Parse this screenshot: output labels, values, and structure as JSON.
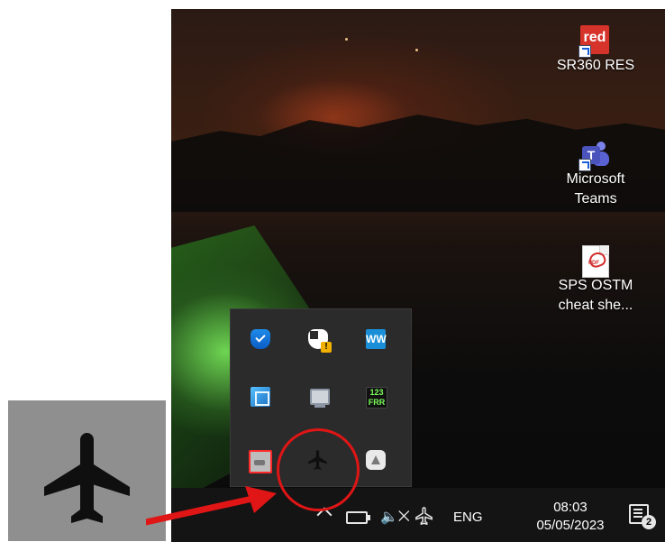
{
  "desktop": {
    "icons": [
      {
        "id": "sr360",
        "label": "SR360 RES",
        "logo_text": "red"
      },
      {
        "id": "teams",
        "label_line1": "Microsoft",
        "label_line2": "Teams",
        "logo_text": "T"
      },
      {
        "id": "pdf",
        "label_line1": "SPS OSTM",
        "label_line2": "cheat she...",
        "logo_text": "PDF"
      }
    ]
  },
  "tray_flyout": {
    "items": [
      {
        "name": "windows-defender-icon"
      },
      {
        "name": "security-warning-icon"
      },
      {
        "name": "audio-wave-icon",
        "glyph": "WW"
      },
      {
        "name": "network-utility-icon"
      },
      {
        "name": "monitor-icon"
      },
      {
        "name": "meter-icon",
        "glyph": "123\nFRR"
      },
      {
        "name": "drive-icon"
      },
      {
        "name": "airplane-mode-icon"
      },
      {
        "name": "google-drive-icon"
      }
    ]
  },
  "taskbar": {
    "language": "ENG",
    "time": "08:03",
    "date": "05/05/2023",
    "notifications_count": "2",
    "mute_glyph": "⨉"
  },
  "colors": {
    "annotation_red": "#e01515",
    "taskbar_bg": "#141414"
  }
}
